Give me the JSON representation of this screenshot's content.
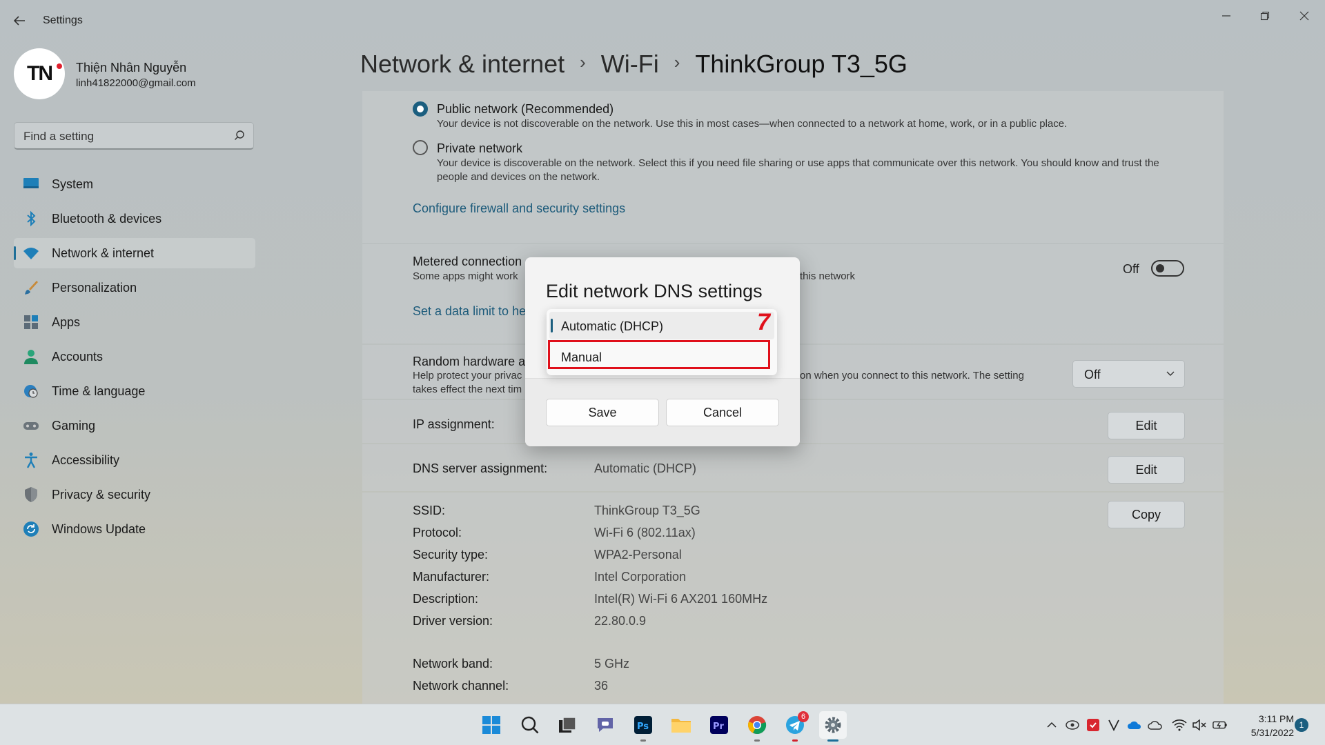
{
  "window": {
    "title": "Settings"
  },
  "profile": {
    "initials": "TN",
    "name": "Thiện Nhân Nguyễn",
    "email": "linh41822000@gmail.com"
  },
  "search": {
    "placeholder": "Find a setting"
  },
  "sidebar": {
    "items": [
      {
        "label": "System",
        "icon": "monitor-icon"
      },
      {
        "label": "Bluetooth & devices",
        "icon": "bluetooth-icon"
      },
      {
        "label": "Network & internet",
        "icon": "wifi-icon",
        "active": true
      },
      {
        "label": "Personalization",
        "icon": "brush-icon"
      },
      {
        "label": "Apps",
        "icon": "apps-icon"
      },
      {
        "label": "Accounts",
        "icon": "person-icon"
      },
      {
        "label": "Time & language",
        "icon": "globe-clock-icon"
      },
      {
        "label": "Gaming",
        "icon": "gamepad-icon"
      },
      {
        "label": "Accessibility",
        "icon": "accessibility-icon"
      },
      {
        "label": "Privacy & security",
        "icon": "shield-icon"
      },
      {
        "label": "Windows Update",
        "icon": "update-icon"
      }
    ]
  },
  "breadcrumb": {
    "items": [
      "Network & internet",
      "Wi-Fi",
      "ThinkGroup T3_5G"
    ]
  },
  "profile_type": {
    "public": {
      "title": "Public network (Recommended)",
      "desc": "Your device is not discoverable on the network. Use this in most cases—when connected to a network at home, work, or in a public place."
    },
    "private": {
      "title": "Private network",
      "desc": "Your device is discoverable on the network. Select this if you need file sharing or use apps that communicate over this network. You should know and trust the people and devices on the network."
    },
    "firewall_link": "Configure firewall and security settings"
  },
  "metered": {
    "title": "Metered connection",
    "desc_left": "Some apps might work",
    "desc_right": "this network",
    "toggle_label": "Off",
    "data_limit_link": "Set a data limit to he"
  },
  "random_hw": {
    "title": "Random hardware ac",
    "desc_line1_left": "Help protect your privac",
    "desc_line1_right": "on when you connect to this network. The setting",
    "desc_line2_left": "takes effect the next tim",
    "select_value": "Off"
  },
  "ip_assignment": {
    "label": "IP assignment:",
    "button": "Edit"
  },
  "dns_assignment": {
    "label": "DNS server assignment:",
    "value": "Automatic (DHCP)",
    "button": "Edit"
  },
  "properties": {
    "copy_button": "Copy",
    "rows": [
      {
        "label": "SSID:",
        "value": "ThinkGroup T3_5G"
      },
      {
        "label": "Protocol:",
        "value": "Wi-Fi 6 (802.11ax)"
      },
      {
        "label": "Security type:",
        "value": "WPA2-Personal"
      },
      {
        "label": "Manufacturer:",
        "value": "Intel Corporation"
      },
      {
        "label": "Description:",
        "value": "Intel(R) Wi-Fi 6 AX201 160MHz"
      },
      {
        "label": "Driver version:",
        "value": "22.80.0.9"
      },
      {
        "label": "Network band:",
        "value": "5 GHz"
      },
      {
        "label": "Network channel:",
        "value": "36"
      }
    ]
  },
  "dialog": {
    "title": "Edit network DNS settings",
    "options": [
      "Automatic (DHCP)",
      "Manual"
    ],
    "save": "Save",
    "cancel": "Cancel",
    "step_marker": "7"
  },
  "taskbar": {
    "telegram_badge": "6",
    "time": "3:11 PM",
    "date": "5/31/2022",
    "notification_count": "1"
  },
  "colors": {
    "accent": "#1b5e7f",
    "highlight": "#e0101b",
    "link": "#1b5a7a"
  }
}
